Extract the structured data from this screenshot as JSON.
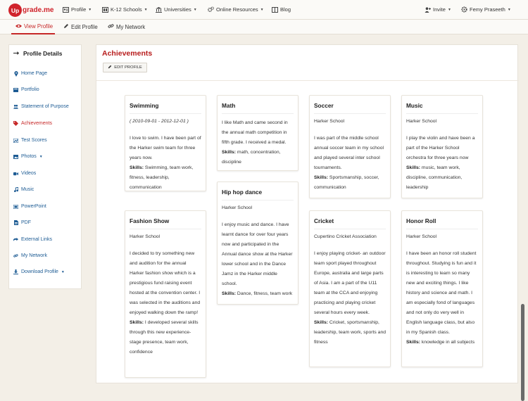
{
  "brand": {
    "logo_mark": "Up",
    "logo_text": "grade.me",
    "color": "#d0232b"
  },
  "topnav": {
    "items": [
      {
        "label": "Profile",
        "icon": "id-card-icon",
        "has_caret": true
      },
      {
        "label": "K-12 Schools",
        "icon": "graduation-cap-icon",
        "has_caret": true
      },
      {
        "label": "Universities",
        "icon": "university-icon",
        "has_caret": true
      },
      {
        "label": "Online Resources",
        "icon": "cogs-icon",
        "has_caret": true
      },
      {
        "label": "Blog",
        "icon": "book-icon",
        "has_caret": false
      }
    ],
    "invite_label": "Invite",
    "user_label": "Femy Praseeth"
  },
  "subnav": {
    "tabs": [
      {
        "label": "View Profile",
        "icon": "eye-icon",
        "active": true
      },
      {
        "label": "Edit Profile",
        "icon": "pencil-icon",
        "active": false
      },
      {
        "label": "My Network",
        "icon": "link-icon",
        "active": false
      }
    ]
  },
  "sidebar": {
    "title": "Profile Details",
    "items": [
      {
        "label": "Home Page",
        "icon": "map-marker-icon",
        "active": false
      },
      {
        "label": "Portfolio",
        "icon": "folder-icon",
        "active": false
      },
      {
        "label": "Statement of Purpose",
        "icon": "user-group-icon",
        "active": false
      },
      {
        "label": "Achievements",
        "icon": "tag-icon",
        "active": true
      },
      {
        "label": "Test Scores",
        "icon": "chart-icon",
        "active": false
      },
      {
        "label": "Photos",
        "icon": "image-icon",
        "active": false,
        "has_caret": true
      },
      {
        "label": "Videos",
        "icon": "video-camera-icon",
        "active": false
      },
      {
        "label": "Music",
        "icon": "music-note-icon",
        "active": false
      },
      {
        "label": "PowerPoint",
        "icon": "slides-icon",
        "active": false
      },
      {
        "label": "PDF",
        "icon": "document-icon",
        "active": false
      },
      {
        "label": "External Links",
        "icon": "external-link-icon",
        "active": false
      },
      {
        "label": "My Network",
        "icon": "link-icon",
        "active": false
      },
      {
        "label": "Download Profile",
        "icon": "download-icon",
        "active": false,
        "has_caret": true
      }
    ]
  },
  "main": {
    "title": "Achievements",
    "edit_button": "EDIT PROFILE",
    "cards": [
      {
        "title": "Swimming",
        "subtitle": "( 2010-09-01 - 2012-12-01 )",
        "description": "I love to swim. I have been part of the Harker swim team for three years now.",
        "skills_label": "Skills:",
        "skills": "Swimming, team work, fitness, leadership, communication"
      },
      {
        "title": "Math",
        "subtitle": "",
        "description": "I like Math and came second in the annual math competition in fifth grade. I received a medal.",
        "skills_label": "Skills:",
        "skills": "math, concentration, discipline"
      },
      {
        "title": "Soccer",
        "subtitle": "Harker School",
        "description": "I was part of the middle school annual soccer team in my school and played several inter school tournaments.",
        "skills_label": "Skills:",
        "skills": "Sportsmanship, soccer, communication"
      },
      {
        "title": "Music",
        "subtitle": "Harker School",
        "description": "I play the violin and have been a part of the Harker School orchestra for three years now",
        "skills_label": "Skills:",
        "skills": "music, team work, discipline, communication, leadership"
      },
      {
        "title": "Hip hop dance",
        "subtitle": "Harker School",
        "description": "I enjoy music and dance. I have learnt dance for over four years now and participated in the Annual dance show at the Harker lower school and in the Dance Jamz in the Harker middle school.",
        "skills_label": "Skills:",
        "skills": "Dance, fitness, team work"
      },
      {
        "title": "Fashion Show",
        "subtitle": "Harker School",
        "description": "I decided to try something new and audition for the annual Harker fashion show which is a prestigious fund raising event hosted at the convention center. I was selected in the auditions and enjoyed walking down the ramp!",
        "skills_label": "Skills:",
        "skills": "I developed several skills through this new experience- stage presence, team work, confidence"
      },
      {
        "title": "Cricket",
        "subtitle": "Cupertino Cricket Association",
        "description": "I enjoy playing cricket- an outdoor team sport played throughout Europe, australia and large parts of Asia. I am a part of the U11 team at the CCA and enjoying practicing and playing cricket several hours every week.",
        "skills_label": "Skills:",
        "skills": "Cricket, sportsmanship, leadership, team work, sports and fitness"
      },
      {
        "title": "Honor Roll",
        "subtitle": "Harker School",
        "description": "I have been an honor roll student throughout. Studying is fun and it is interesting to learn so many new and exciting things. I like history and science and math. I am especially fond of languages and not only do very well in English language class, but also in my Spanish class.",
        "skills_label": "Skills:",
        "skills": "knowledge in all subjects"
      }
    ]
  }
}
